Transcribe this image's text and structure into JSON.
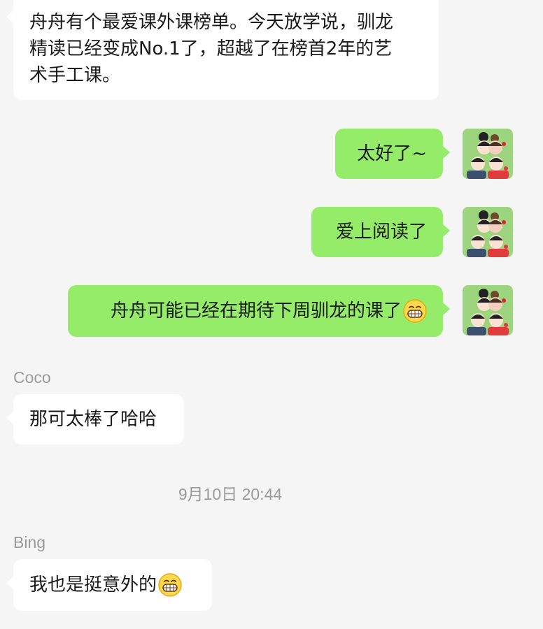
{
  "messages": [
    {
      "sender": "",
      "text_lines": [
        "舟舟有个最爱课外课榜单。今天放学说，驯龙",
        "精读已经变成No.1了，超越了在榜首2年的艺",
        "术手工课。"
      ]
    },
    {
      "sender": "me",
      "text": "太好了~"
    },
    {
      "sender": "me",
      "text": "爱上阅读了"
    },
    {
      "sender": "me",
      "text": "舟舟可能已经在期待下周驯龙的课了",
      "emoji": "grinning-face-emoji"
    },
    {
      "sender": "Coco",
      "text": "那可太棒了哈哈"
    },
    {
      "sender": "Bing",
      "text": "我也是挺意外的",
      "emoji": "grinning-face-emoji"
    }
  ],
  "timestamp": "9月10日 20:44",
  "colors": {
    "background": "#f5f5f5",
    "incoming_bubble": "#ffffff",
    "outgoing_bubble": "#95ec69",
    "meta_text": "#9a9a9a",
    "avatar_background": "#9dd47e"
  },
  "icons": {
    "avatar": "cartoon-family-avatar",
    "emoji": "grinning-face-emoji"
  }
}
